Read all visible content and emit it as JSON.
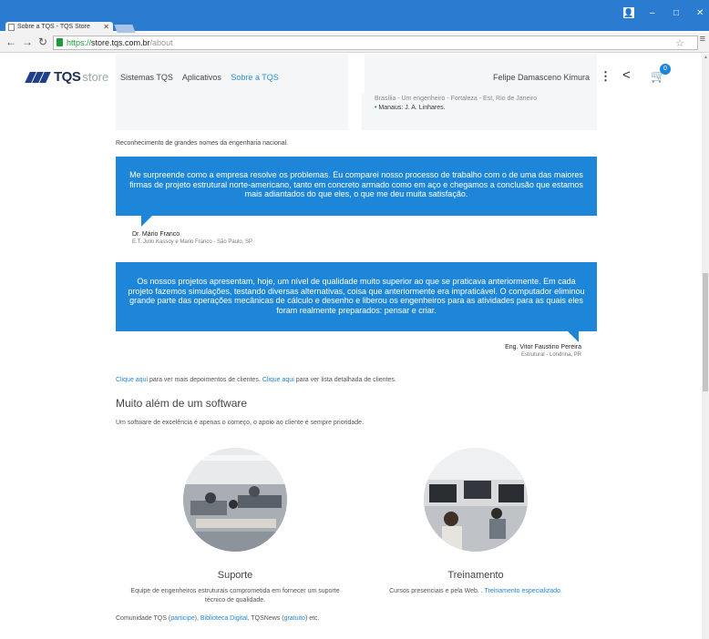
{
  "browser": {
    "tab_title": "Sobre a TQS - TQS Store",
    "url_https": "https://",
    "url_host": "store.tqs.com.br",
    "url_path": "/about"
  },
  "header": {
    "logo_text": "TQS",
    "logo_store": "store",
    "nav": [
      "Sistemas TQS",
      "Aplicativos",
      "Sobre a TQS"
    ],
    "user_name": "Felipe Damasceno Kimura",
    "cart_count": "0"
  },
  "top_box": {
    "faded_line": "Brasília - Um engenheiro - Fortaleza - Est, Rio de Janeiro",
    "bullet": "Manaus: J. A. Linhares."
  },
  "recognition": "Reconhecimento de grandes nomes da engenharia nacional.",
  "testimonials": [
    {
      "text": "Me surpreende como a empresa resolve os problemas. Eu comparei nosso processo de trabalho com o de uma das maiores firmas de projeto estrutural norte-americano, tanto em concreto armado como em aço e chegamos a conclusão que estamos mais adiantados do que eles, o que me deu muita satisfação.",
      "author": "Dr. Mário Franco",
      "role": "E.T. Julio Kassoy e Mario Franco · São Paulo, SP"
    },
    {
      "text": "Os nossos projetos apresentam, hoje, um nível de qualidade muito superior ao que se praticava anteriormente. Em cada projeto fazemos simulações, testando diversas alternativas, coisa que anteriormente era impraticável. O computador eliminou grande parte das operações mecânicas de cálculo e desenho e liberou os engenheiros para as atividades para as quais eles foram realmente preparados: pensar e criar.",
      "author": "Eng. Vitor Faustino Pereira",
      "role": "Estrutural - Londrina, PR"
    }
  ],
  "links_line": {
    "link1": "Clique aqui",
    "text1": " para ver mais depoimentos de clientes. ",
    "link2": "Clique aqui",
    "text2": " para ver lista detalhada de clientes."
  },
  "section": {
    "title": "Muito além de um software",
    "subtitle": "Um software de excelência é apenas o começo, o apoio ao cliente é sempre prioridade."
  },
  "features": [
    {
      "title": "Suporte",
      "desc": "Equipe de engenheiros estruturais comprometida em fornecer um suporte técnico de qualidade."
    },
    {
      "title": "Treinamento",
      "desc": "Cursos presenciais e pela Web. . ",
      "link": "Treinamento especializado."
    }
  ],
  "community": {
    "text1": "Comunidade TQS (",
    "link1": "participe",
    "text2": "), ",
    "link2": "Biblioteca Digital",
    "text3": ", TQSNews (",
    "link3": "gratuito",
    "text4": ") etc."
  }
}
